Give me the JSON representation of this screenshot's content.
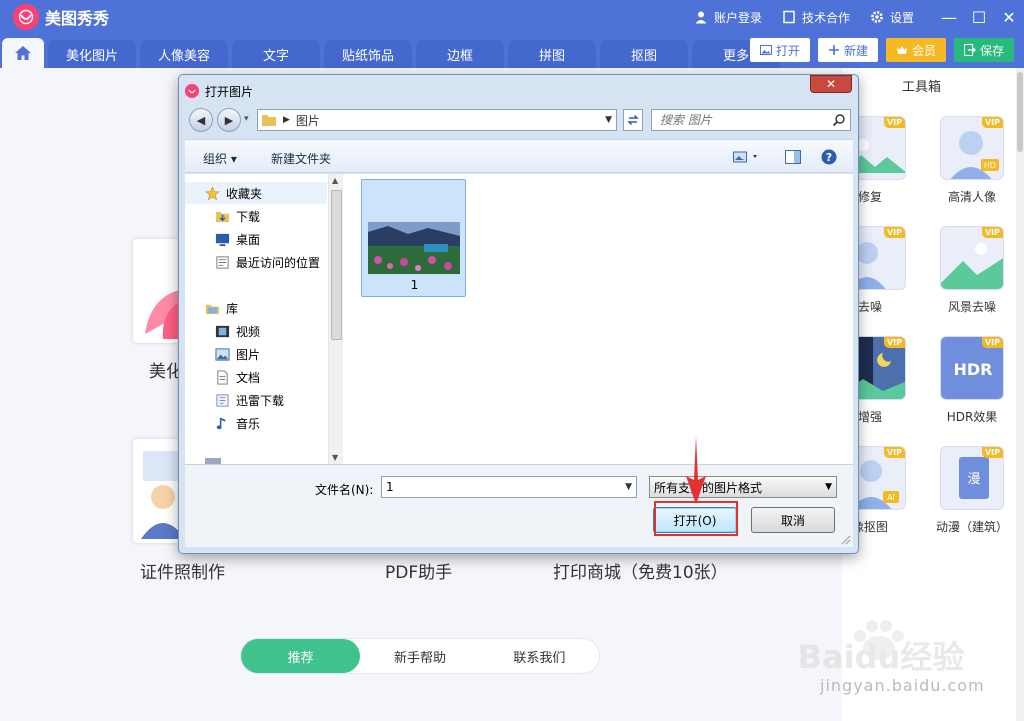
{
  "app": {
    "title": "美图秀秀",
    "account_login": "账户登录",
    "tech_partner": "技术合作",
    "settings": "设置",
    "minimize": "—",
    "maximize": "☐",
    "close": "✕"
  },
  "tabs": [
    {
      "label": "美化图片"
    },
    {
      "label": "人像美容"
    },
    {
      "label": "文字"
    },
    {
      "label": "贴纸饰品"
    },
    {
      "label": "边框"
    },
    {
      "label": "拼图"
    },
    {
      "label": "抠图"
    },
    {
      "label": "更多"
    }
  ],
  "actions": {
    "open": "打开",
    "new": "新建",
    "vip": "会员",
    "save": "保存"
  },
  "background": {
    "labels": {
      "beautify_partial": "美化",
      "id_photo": "证件照制作",
      "pdf": "PDF助手",
      "print": "打印商城（免费10张）"
    },
    "bottom_tabs": [
      {
        "label": "推荐"
      },
      {
        "label": "新手帮助"
      },
      {
        "label": "联系我们"
      }
    ]
  },
  "toolbox": {
    "title": "工具箱",
    "vip_label": "VIP",
    "items": [
      {
        "label": "照片修复"
      },
      {
        "label": "高清人像"
      },
      {
        "label": "人像去噪"
      },
      {
        "label": "风景去噪"
      },
      {
        "label": "夜景增强"
      },
      {
        "label": "HDR效果"
      },
      {
        "label": "AI人像抠图"
      },
      {
        "label": "动漫（建筑）"
      }
    ],
    "icon_texts": {
      "hd": "HD",
      "hdr": "HDR",
      "ai": "AI",
      "manga": "漫"
    }
  },
  "dialog": {
    "title": "打开图片",
    "close": "✕",
    "address": "图片",
    "search_placeholder": "搜索 图片",
    "organize": "组织 ▾",
    "new_folder": "新建文件夹",
    "nav": {
      "favorites": "收藏夹",
      "downloads": "下载",
      "desktop": "桌面",
      "recent": "最近访问的位置",
      "library": "库",
      "videos": "视频",
      "pictures": "图片",
      "documents": "文档",
      "xunlei": "迅雷下载",
      "music": "音乐"
    },
    "file": {
      "name": "1"
    },
    "filename_label": "文件名(N):",
    "filename_value": "1",
    "filetype": "所有支持的图片格式",
    "open_button": "打开(O)",
    "cancel_button": "取消"
  },
  "watermark": {
    "brand": "Baidu经验",
    "url": "jingyan.baidu.com"
  },
  "colors": {
    "brand_blue": "#4f72d9",
    "brand_pink": "#ff3f73",
    "vip_gold": "#f6b823",
    "save_green": "#27ba7c",
    "pill_green": "#3fc28e",
    "highlight_red": "#e23131"
  }
}
